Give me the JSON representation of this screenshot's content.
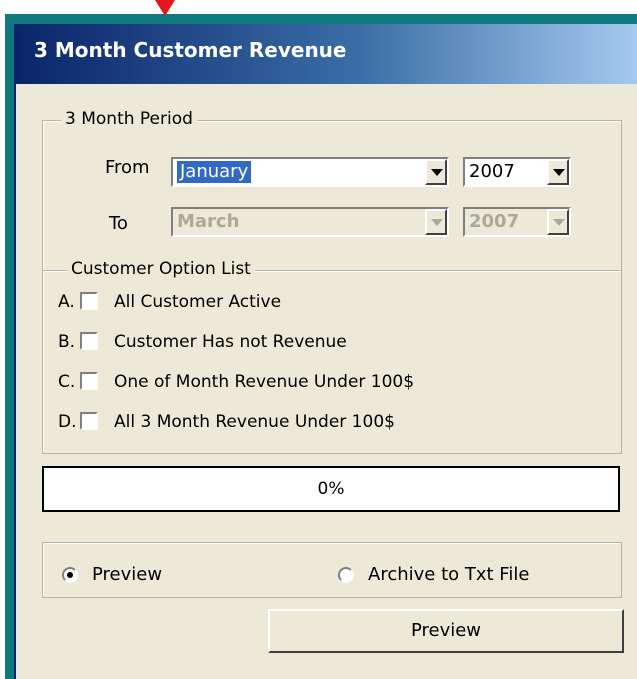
{
  "window": {
    "title": "3 Month Customer Revenue"
  },
  "period": {
    "legend": "3 Month Period",
    "from_label": "From",
    "to_label": "To",
    "from_month": "January",
    "from_year": "2007",
    "to_month": "March",
    "to_year": "2007"
  },
  "options": {
    "legend": "Customer Option List",
    "items": [
      {
        "letter": "A.",
        "label": "All Customer Active"
      },
      {
        "letter": "B.",
        "label": "Customer Has not Revenue"
      },
      {
        "letter": "C.",
        "label": "One of Month Revenue Under 100$"
      },
      {
        "letter": "D.",
        "label": "All 3 Month Revenue Under 100$"
      }
    ]
  },
  "progress": {
    "value_text": "0%",
    "value": 0
  },
  "output": {
    "preview_label": "Preview",
    "archive_label": "Archive to Txt File",
    "selected": "preview"
  },
  "actions": {
    "preview_button": "Preview"
  },
  "colors": {
    "accent": "#0a246a",
    "arrow": "#e5161b",
    "selection": "#316ac5"
  }
}
